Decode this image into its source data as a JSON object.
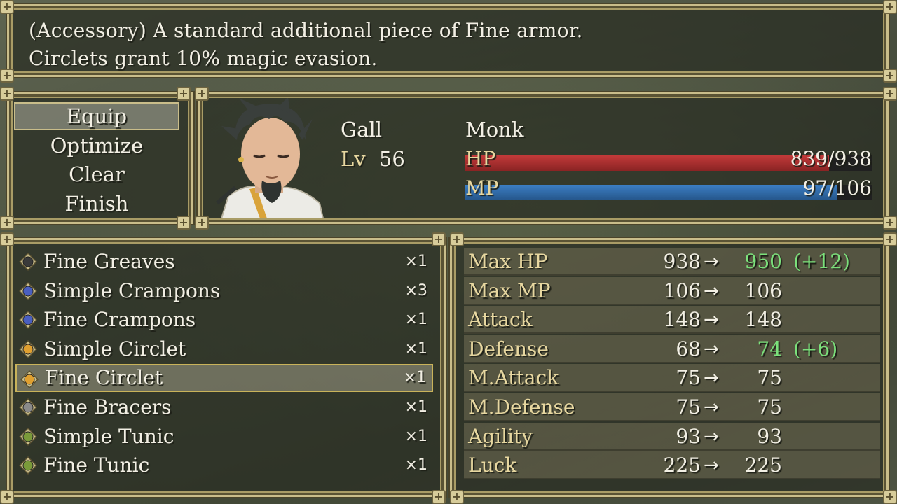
{
  "help": {
    "line1": "(Accessory) A standard additional piece of Fine armor.",
    "line2": "Circlets grant 10% magic evasion."
  },
  "commands": [
    {
      "label": "Equip",
      "selected": true
    },
    {
      "label": "Optimize",
      "selected": false
    },
    {
      "label": "Clear",
      "selected": false
    },
    {
      "label": "Finish",
      "selected": false
    }
  ],
  "actor": {
    "name": "Gall",
    "level_label": "Lv",
    "level": "56",
    "class": "Monk",
    "hp_label": "HP",
    "hp_value": "839/938",
    "hp_ratio": 0.894,
    "mp_label": "MP",
    "mp_value": "97/106",
    "mp_ratio": 0.915,
    "colors": {
      "hp": "#c23a3a",
      "mp": "#3c7ec4"
    }
  },
  "items": [
    {
      "name": "Fine Greaves",
      "qty": "×1",
      "icon": "greaves-icon",
      "selected": false
    },
    {
      "name": "Simple Crampons",
      "qty": "×3",
      "icon": "crampons-icon",
      "selected": false
    },
    {
      "name": "Fine Crampons",
      "qty": "×1",
      "icon": "crampons-icon",
      "selected": false
    },
    {
      "name": "Simple Circlet",
      "qty": "×1",
      "icon": "circlet-icon",
      "selected": false
    },
    {
      "name": "Fine Circlet",
      "qty": "×1",
      "icon": "circlet-icon",
      "selected": true
    },
    {
      "name": "Fine Bracers",
      "qty": "×1",
      "icon": "bracers-icon",
      "selected": false
    },
    {
      "name": "Simple Tunic",
      "qty": "×1",
      "icon": "tunic-icon",
      "selected": false
    },
    {
      "name": "Fine Tunic",
      "qty": "×1",
      "icon": "tunic-icon",
      "selected": false
    }
  ],
  "stats": [
    {
      "label": "Max HP",
      "current": "938",
      "arrow": "→",
      "new": "950",
      "diff": "(+12)",
      "up": true
    },
    {
      "label": "Max MP",
      "current": "106",
      "arrow": "→",
      "new": "106",
      "diff": "",
      "up": false
    },
    {
      "label": "Attack",
      "current": "148",
      "arrow": "→",
      "new": "148",
      "diff": "",
      "up": false
    },
    {
      "label": "Defense",
      "current": "68",
      "arrow": "→",
      "new": "74",
      "diff": "(+6)",
      "up": true
    },
    {
      "label": "M.Attack",
      "current": "75",
      "arrow": "→",
      "new": "75",
      "diff": "",
      "up": false
    },
    {
      "label": "M.Defense",
      "current": "75",
      "arrow": "→",
      "new": "75",
      "diff": "",
      "up": false
    },
    {
      "label": "Agility",
      "current": "93",
      "arrow": "→",
      "new": "93",
      "diff": "",
      "up": false
    },
    {
      "label": "Luck",
      "current": "225",
      "arrow": "→",
      "new": "225",
      "diff": "",
      "up": false
    }
  ]
}
